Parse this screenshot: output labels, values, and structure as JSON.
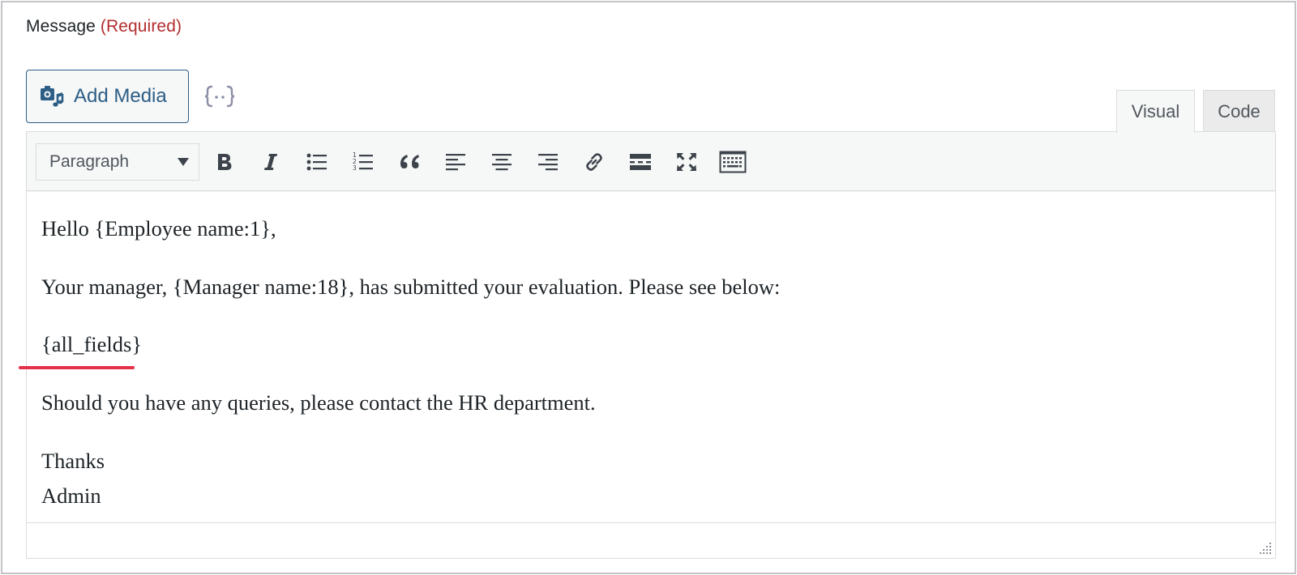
{
  "field": {
    "label": "Message",
    "required": "(Required)"
  },
  "media": {
    "add_label": "Add Media",
    "merge_tags_icon": "merge-tags-braces-icon"
  },
  "tabs": [
    {
      "label": "Visual",
      "active": true
    },
    {
      "label": "Code",
      "active": false
    }
  ],
  "toolbar": {
    "format_selected": "Paragraph",
    "buttons": [
      "bold-icon",
      "italic-icon",
      "bulleted-list-icon",
      "numbered-list-icon",
      "blockquote-icon",
      "align-left-icon",
      "align-center-icon",
      "align-right-icon",
      "link-icon",
      "read-more-icon",
      "fullscreen-icon",
      "toolbar-toggle-icon"
    ]
  },
  "content": {
    "greeting": "Hello {Employee name:1},",
    "body": "Your manager, {Manager name:18}, has submitted your evaluation. Please see below:",
    "merge_tag": "{all_fields}",
    "queries": "Should you have any queries, please contact the HR department.",
    "thanks": "Thanks",
    "signature": "Admin"
  },
  "colors": {
    "accent": "#2c5e86",
    "required": "#b32d2e",
    "underline": "#e5304a",
    "toolbar_bg": "#f6f7f7",
    "border": "#dcdcde"
  }
}
